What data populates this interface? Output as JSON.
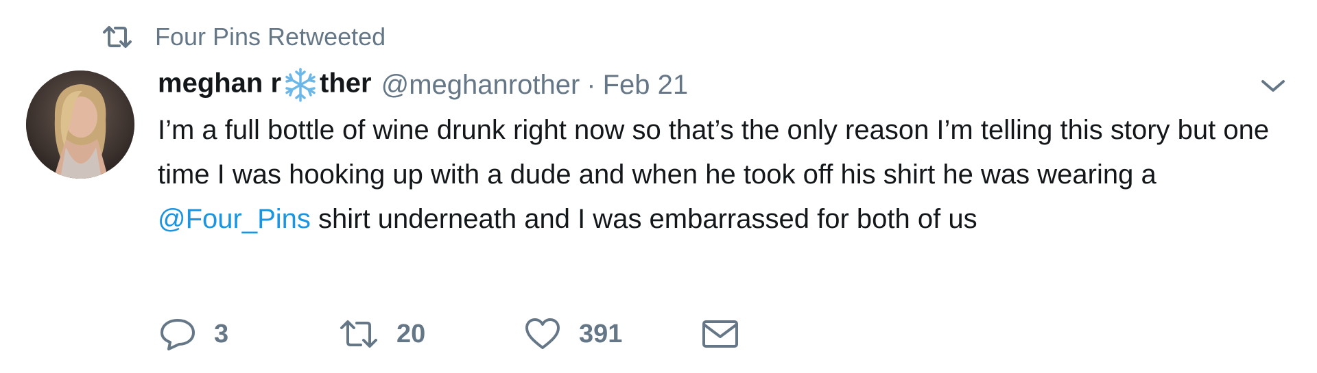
{
  "context": {
    "icon": "retweet-icon",
    "text": "Four Pins Retweeted"
  },
  "author": {
    "avatar": "avatar",
    "name_part1": "meghan r",
    "name_icon": "snowflake-icon",
    "name_part2": "ther",
    "handle": "@meghanrother",
    "separator": "·",
    "date": "Feb 21"
  },
  "tweet": {
    "text_before": "I’m a full bottle of wine drunk right now so that’s the only reason I’m telling this story but one time I was hooking up with a dude and when he took off his shirt he was wearing a ",
    "mention": "@Four_Pins",
    "text_after": " shirt underneath and I was embarrassed for both of us"
  },
  "actions": {
    "reply": {
      "icon": "reply-icon",
      "count": "3"
    },
    "retweet": {
      "icon": "retweet-icon",
      "count": "20"
    },
    "like": {
      "icon": "heart-icon",
      "count": "391"
    },
    "message": {
      "icon": "envelope-icon"
    }
  },
  "colors": {
    "text": "#14171a",
    "secondary": "#657786",
    "link": "#1b95e0",
    "snowflake": "#6ab7e8"
  }
}
